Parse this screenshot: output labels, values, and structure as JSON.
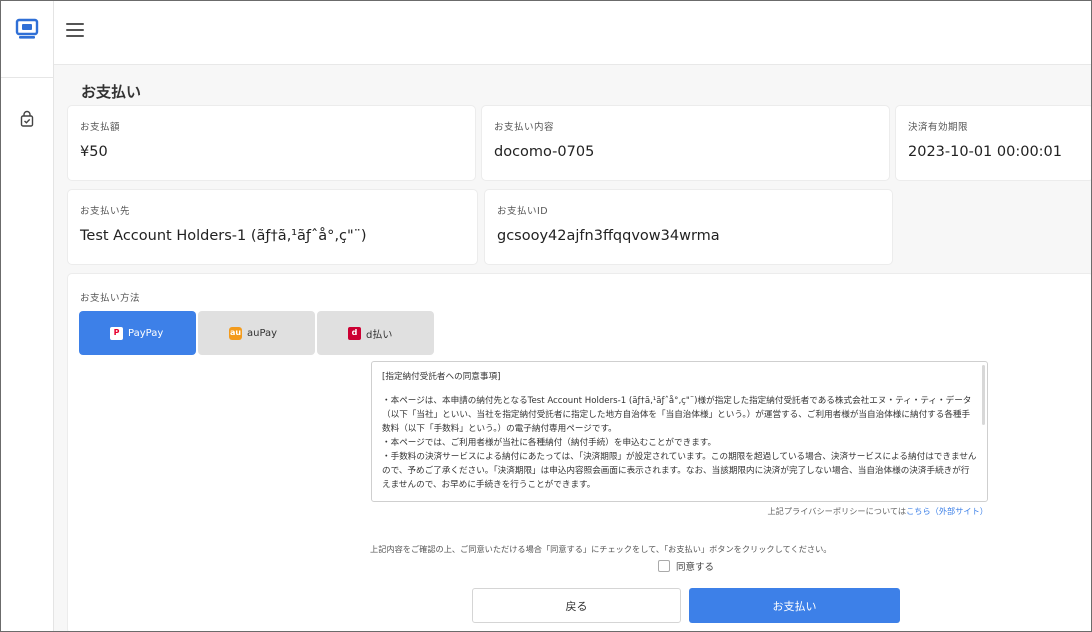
{
  "header": {
    "menu_icon": "menu-icon"
  },
  "sidebar": {
    "logo_icon": "payment-app-icon",
    "item_icon": "shopping-bag-check-icon"
  },
  "page": {
    "title": "お支払い"
  },
  "summary": {
    "amount_label": "お支払額",
    "amount_value": "¥50",
    "content_label": "お支払い内容",
    "content_value": "docomo-0705",
    "deadline_label": "決済有効期限",
    "deadline_value": "2023-10-01 00:00:01",
    "payee_label": "お支払い先",
    "payee_value": "Test Account Holders-1 (ãƒ†ã‚¹ãƒˆå°‚ç\"¨)",
    "payid_label": "お支払いID",
    "payid_value": "gcsooy42ajfn3ffqqvow34wrma"
  },
  "method": {
    "label": "お支払い方法",
    "tabs": [
      {
        "label": "PayPay",
        "icon": "paypay-icon",
        "active": true
      },
      {
        "label": "auPay",
        "icon": "aupay-icon",
        "active": false
      },
      {
        "label": "d払い",
        "icon": "dpay-icon",
        "active": false
      }
    ]
  },
  "terms": {
    "heading": "[指定納付受託者への同意事項]",
    "lines": [
      "・本ページは、本申請の納付先となるTest Account Holders-1 (ãƒ†ã‚¹ãƒˆå°‚ç\"¨)様が指定した指定納付受託者である株式会社エヌ・ティ・ティ・データ（以下「当社」といい、当社を指定納付受託者に指定した地方自治体を「当自治体様」という。）が運営する、ご利用者様が当自治体様に納付する各種手数料（以下「手数料」という。）の電子納付専用ページです。",
      "・本ページでは、ご利用者様が当社に各種納付（納付手続）を申込むことができます。",
      "・手数料の決済サービスによる納付にあたっては、「決済期限」が設定されています。この期限を超過している場合、決済サービスによる納付はできませんので、予めご了承ください。「決済期限」は申込内容照会画面に表示されます。なお、当該期限内に決済が完了しない場合、当自治体様の決済手続きが行えませんので、お早めに手続きを行うことができます。"
    ]
  },
  "privacy": {
    "text": "上記プライバシーポリシーについては",
    "link": "こちら（外部サイト）"
  },
  "consent": {
    "instruction": "上記内容をご確認の上、ご同意いただける場合「同意する」にチェックをして、「お支払い」ボタンをクリックしてください。",
    "checkbox_label": "同意する",
    "checked": false
  },
  "buttons": {
    "back": "戻る",
    "pay": "お支払い"
  },
  "colors": {
    "accent": "#3d80e8",
    "paypay_red": "#e8002d",
    "aupay_orange": "#f39b1d",
    "dpay_red": "#cc0033"
  }
}
